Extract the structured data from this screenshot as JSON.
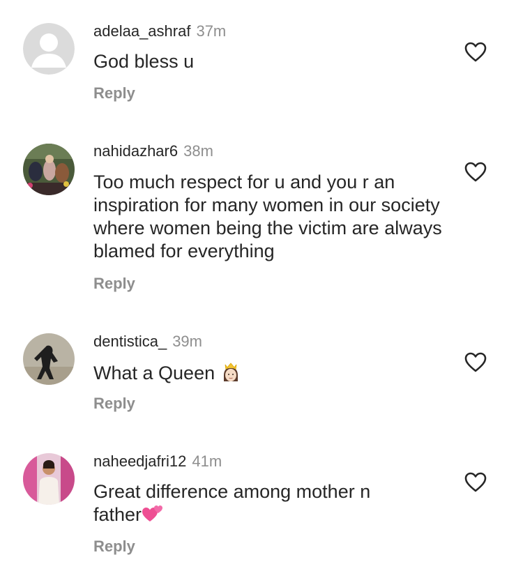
{
  "comments": [
    {
      "username": "adelaa_ashraf",
      "time": "37m",
      "text": "God bless u",
      "reply": "Reply",
      "avatar_icon": "default-avatar-icon"
    },
    {
      "username": "nahidazhar6",
      "time": "38m",
      "text": "Too much respect for u and you r an inspiration for many women in our society where women being the victim are always blamed for everything",
      "reply": "Reply",
      "avatar_icon": "user-photo-avatar"
    },
    {
      "username": "dentistica_",
      "time": "39m",
      "text": "What a Queen",
      "emoji": "queen-emoji",
      "reply": "Reply",
      "avatar_icon": "user-photo-avatar"
    },
    {
      "username": "naheedjafri12",
      "time": "41m",
      "text": "Great difference among mother n father",
      "emoji": "two-hearts-emoji",
      "reply": "Reply",
      "avatar_icon": "user-photo-avatar"
    }
  ],
  "colors": {
    "text": "#262626",
    "secondary": "#8e8e8e",
    "heart_outline": "#262626"
  }
}
